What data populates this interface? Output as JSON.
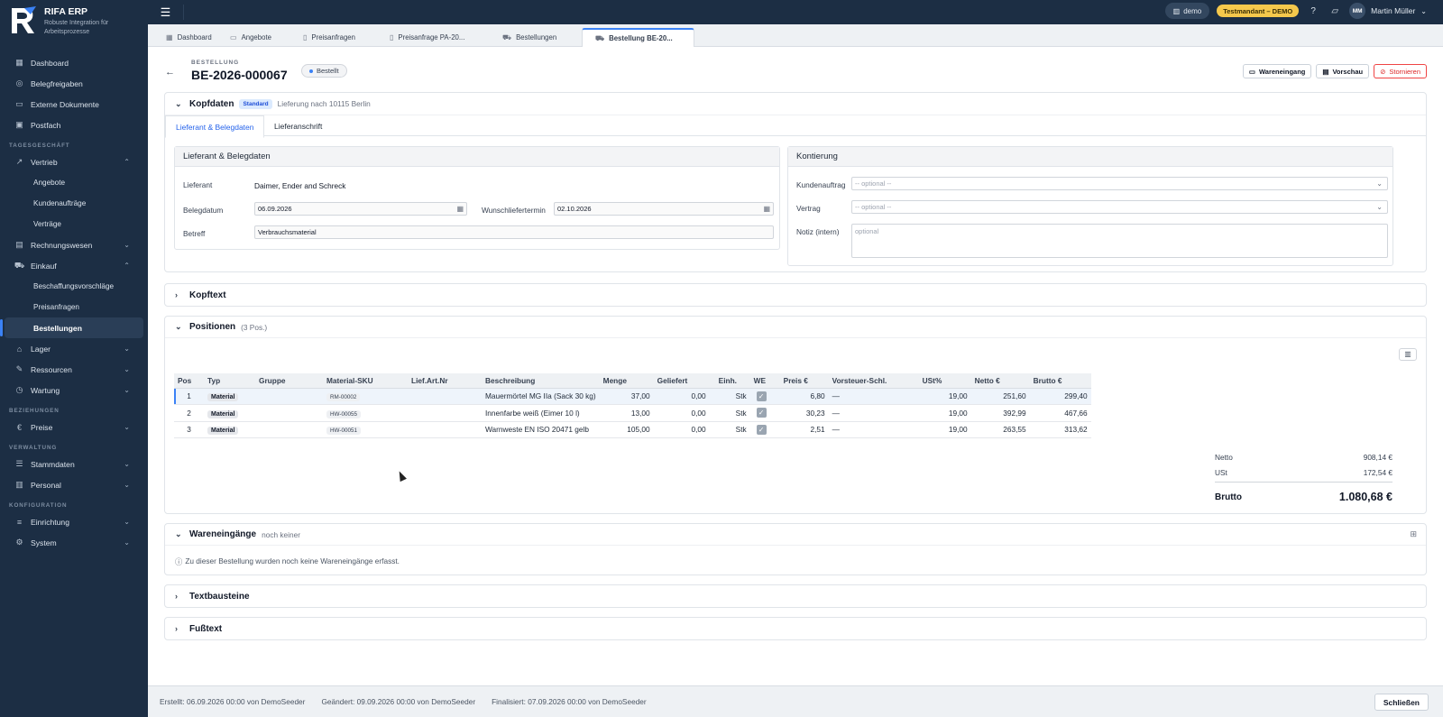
{
  "brand": {
    "name": "RIFA ERP",
    "tagline": "Robuste Integration für Arbeitsprozesse",
    "logo_letter": "R"
  },
  "sidebar": {
    "items_top": [
      {
        "label": "Dashboard",
        "icon": "grid-icon"
      },
      {
        "label": "Belegfreigaben",
        "icon": "check-circle-icon"
      },
      {
        "label": "Externe Dokumente",
        "icon": "folder-icon"
      },
      {
        "label": "Postfach",
        "icon": "inbox-icon"
      }
    ],
    "section_tagesgeschaeft": "TAGESGESCHÄFT",
    "vertrieb": "Vertrieb",
    "vertrieb_sub": [
      "Angebote",
      "Kundenaufträge",
      "Verträge"
    ],
    "rechnungswesen": "Rechnungswesen",
    "einkauf": "Einkauf",
    "einkauf_sub": [
      "Beschaffungsvorschläge",
      "Preisanfragen",
      "Bestellungen"
    ],
    "lager": "Lager",
    "ressourcen": "Ressourcen",
    "wartung": "Wartung",
    "section_beziehungen": "BEZIEHUNGEN",
    "preise": "Preise",
    "section_verwaltung": "VERWALTUNG",
    "stammdaten": "Stammdaten",
    "personal": "Personal",
    "section_konfiguration": "KONFIGURATION",
    "einrichtung": "Einrichtung",
    "system": "System"
  },
  "topbar": {
    "tenant": "demo",
    "environment": "Testmandant – DEMO",
    "user_initials": "MM",
    "user_name": "Martin Müller"
  },
  "tabs": [
    "Dashboard",
    "Angebote",
    "Preisanfragen",
    "Preisanfrage PA-20...",
    "Bestellungen",
    "Bestellung BE-20..."
  ],
  "document": {
    "eyebrow": "BESTELLUNG",
    "number": "BE-2026-000067",
    "status": "Bestellt",
    "actions": {
      "wareneingang": "Wareneingang",
      "vorschau": "Vorschau",
      "stornieren": "Stornieren"
    }
  },
  "kopfdaten": {
    "title": "Kopfdaten",
    "badge": "Standard",
    "note": "Lieferung nach 10115 Berlin",
    "subtabs": [
      "Lieferant & Belegdaten",
      "Lieferanschrift"
    ],
    "left_panel": {
      "title": "Lieferant & Belegdaten",
      "lieferant_label": "Lieferant",
      "lieferant_value": "Daimer, Ender and Schreck",
      "belegdatum_label": "Belegdatum",
      "belegdatum_value": "06.09.2026",
      "wunschliefertermin_label": "Wunschliefertermin",
      "wunschliefertermin_value": "02.10.2026",
      "betreff_label": "Betreff",
      "betreff_value": "Verbrauchsmaterial"
    },
    "right_panel": {
      "title": "Kontierung",
      "kundenauftrag_label": "Kundenauftrag",
      "kundenauftrag_placeholder": "-- optional --",
      "vertrag_label": "Vertrag",
      "vertrag_placeholder": "-- optional --",
      "notiz_label": "Notiz (intern)",
      "notiz_placeholder": "optional"
    }
  },
  "kopftext": {
    "title": "Kopftext"
  },
  "positionen": {
    "title": "Positionen",
    "count": "(3 Pos.)",
    "columns": [
      "Pos",
      "Typ",
      "Gruppe",
      "Material-SKU",
      "Lief.Art.Nr",
      "Beschreibung",
      "Menge",
      "Geliefert",
      "Einh.",
      "WE",
      "Preis €",
      "Vorsteuer-Schl.",
      "USt%",
      "Netto €",
      "Brutto €"
    ],
    "rows": [
      {
        "pos": "1",
        "typ": "Material",
        "gruppe": "",
        "sku": "RM-00002",
        "lief": "",
        "desc": "Mauermörtel MG IIa (Sack 30 kg)",
        "menge": "37,00",
        "geliefert": "0,00",
        "einh": "Stk",
        "preis": "6,80",
        "vst": "—",
        "ust": "19,00",
        "netto": "251,60",
        "brutto": "299,40"
      },
      {
        "pos": "2",
        "typ": "Material",
        "gruppe": "",
        "sku": "HW-00055",
        "lief": "",
        "desc": "Innenfarbe weiß (Eimer 10 l)",
        "menge": "13,00",
        "geliefert": "0,00",
        "einh": "Stk",
        "preis": "30,23",
        "vst": "—",
        "ust": "19,00",
        "netto": "392,99",
        "brutto": "467,66"
      },
      {
        "pos": "3",
        "typ": "Material",
        "gruppe": "",
        "sku": "HW-00051",
        "lief": "",
        "desc": "Warnweste EN ISO 20471 gelb",
        "menge": "105,00",
        "geliefert": "0,00",
        "einh": "Stk",
        "preis": "2,51",
        "vst": "—",
        "ust": "19,00",
        "netto": "263,55",
        "brutto": "313,62"
      }
    ],
    "totals": {
      "netto_label": "Netto",
      "netto_value": "908,14 €",
      "ust_label": "USt",
      "ust_value": "172,54 €",
      "brutto_label": "Brutto",
      "brutto_value": "1.080,68 €"
    }
  },
  "wareneingaenge": {
    "title": "Wareneingänge",
    "note": "noch keiner",
    "empty": "Zu dieser Bestellung wurden noch keine Wareneingänge erfasst."
  },
  "textbausteine": {
    "title": "Textbausteine"
  },
  "fusstext": {
    "title": "Fußtext"
  },
  "footer": {
    "erstellt": "Erstellt: 06.09.2026 00:00 von DemoSeeder",
    "geaendert": "Geändert: 09.09.2026 00:00 von DemoSeeder",
    "finalisiert": "Finalisiert: 07.09.2026 00:00 von DemoSeeder",
    "close": "Schließen"
  }
}
